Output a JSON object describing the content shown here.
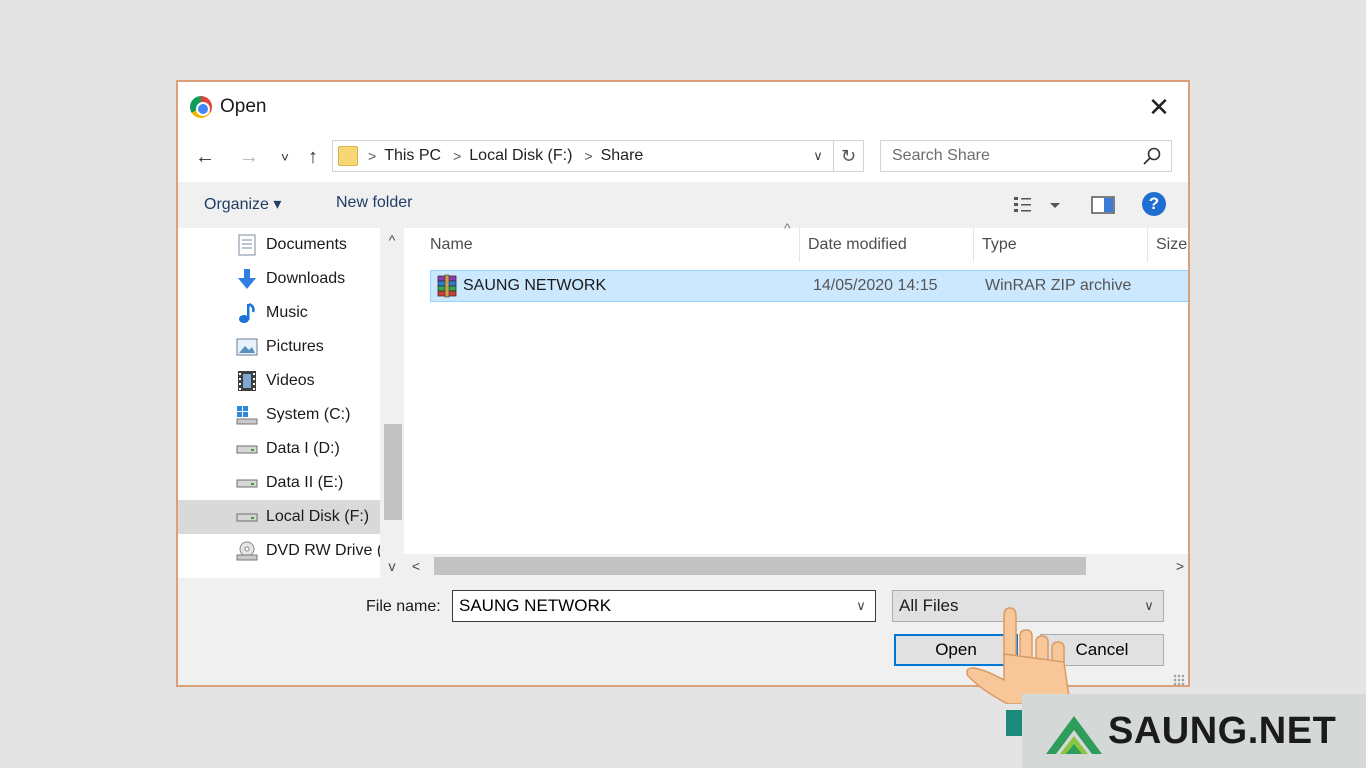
{
  "window": {
    "title": "Open",
    "close_icon": "✕"
  },
  "navigation": {
    "back_icon": "←",
    "forward_icon": "→",
    "recent_icon": "˅",
    "up_icon": "↑",
    "breadcrumb": [
      "This PC",
      "Local Disk (F:)",
      "Share"
    ],
    "separator": ">",
    "refresh_icon": "↻",
    "dropdown_icon": "∨"
  },
  "search": {
    "placeholder": "Search Share"
  },
  "toolbar": {
    "organize_label": "Organize ▾",
    "new_folder_label": "New folder",
    "help_label": "?"
  },
  "sidebar": {
    "items": [
      {
        "label": "Documents",
        "icon": "documents-icon"
      },
      {
        "label": "Downloads",
        "icon": "downloads-icon"
      },
      {
        "label": "Music",
        "icon": "music-icon"
      },
      {
        "label": "Pictures",
        "icon": "pictures-icon"
      },
      {
        "label": "Videos",
        "icon": "videos-icon"
      },
      {
        "label": "System (C:)",
        "icon": "windows-drive-icon"
      },
      {
        "label": "Data I (D:)",
        "icon": "drive-icon"
      },
      {
        "label": "Data II (E:)",
        "icon": "drive-icon"
      },
      {
        "label": "Local Disk (F:)",
        "icon": "drive-icon",
        "selected": true
      },
      {
        "label": "DVD RW Drive (G:)",
        "icon": "dvd-drive-icon"
      }
    ],
    "scroll_up": "^",
    "scroll_down": "v"
  },
  "file_list": {
    "columns": [
      "Name",
      "Date modified",
      "Type",
      "Size"
    ],
    "sort_indicator": "^",
    "rows": [
      {
        "name": "SAUNG NETWORK",
        "date_modified": "14/05/2020 14:15",
        "type": "WinRAR ZIP archive",
        "selected": true
      }
    ],
    "scroll_left": "<",
    "scroll_right": ">"
  },
  "footer": {
    "file_name_label": "File name:",
    "file_name_value": "SAUNG NETWORK",
    "filter_value": "All Files",
    "open_label": "Open",
    "cancel_label": "Cancel"
  },
  "watermark": {
    "text": "SAUNG.NET"
  },
  "colors": {
    "dialog_border": "#d9a07a",
    "selection": "#cce8ff",
    "accent": "#0078d7",
    "watermark_green": "#2e9c5a"
  }
}
